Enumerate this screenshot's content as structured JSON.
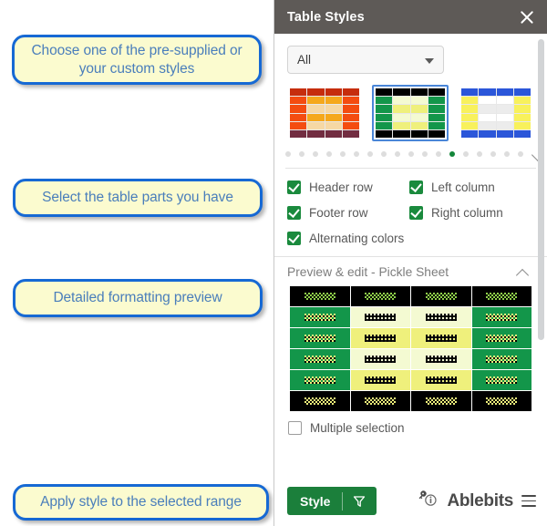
{
  "callouts": [
    {
      "id": "choose-style",
      "text": "Choose one of the pre-supplied or your custom styles"
    },
    {
      "id": "table-parts",
      "text": "Select the table parts you have"
    },
    {
      "id": "preview",
      "text": "Detailed formatting preview"
    },
    {
      "id": "apply",
      "text": "Apply style to the selected range"
    }
  ],
  "callout_colors": {
    "fill": "#fbfbcf",
    "border": "#1669d4",
    "text": "#4a7ebb"
  },
  "panel": {
    "title": "Table Styles",
    "close_icon": "close-icon",
    "titlebar_color": "#5e5a57",
    "filter": {
      "value": "All",
      "icon": "chevron-down-icon"
    },
    "thumbnails": [
      {
        "name": "orange-red-style",
        "selected": false,
        "rows": [
          [
            "#c62d0d",
            "#c62d0d",
            "#c62d0d",
            "#c62d0d"
          ],
          [
            "#f44c10",
            "#f5a81c",
            "#f5a81c",
            "#f44c10"
          ],
          [
            "#f44c10",
            "#f6d8a4",
            "#f6d8a4",
            "#f44c10"
          ],
          [
            "#f44c10",
            "#f5a81c",
            "#f5a81c",
            "#f44c10"
          ],
          [
            "#f44c10",
            "#f6d8a4",
            "#f6d8a4",
            "#f44c10"
          ],
          [
            "#722d41",
            "#722d41",
            "#722d41",
            "#722d41"
          ]
        ]
      },
      {
        "name": "green-yellow-style",
        "selected": true,
        "rows": [
          [
            "#000000",
            "#000000",
            "#000000",
            "#000000"
          ],
          [
            "#13964a",
            "#f4fad2",
            "#f4fad2",
            "#13964a"
          ],
          [
            "#13964a",
            "#eff07c",
            "#eff07c",
            "#13964a"
          ],
          [
            "#13964a",
            "#f4fad2",
            "#f4fad2",
            "#13964a"
          ],
          [
            "#13964a",
            "#eff07c",
            "#eff07c",
            "#13964a"
          ],
          [
            "#000000",
            "#000000",
            "#000000",
            "#000000"
          ]
        ]
      },
      {
        "name": "blue-yellow-style",
        "selected": false,
        "rows": [
          [
            "#2b56d9",
            "#2b56d9",
            "#2b56d9",
            "#2b56d9"
          ],
          [
            "#f8f15c",
            "#ffffff",
            "#ffffff",
            "#f8f15c"
          ],
          [
            "#f8f15c",
            "#ececec",
            "#ececec",
            "#f8f15c"
          ],
          [
            "#f8f15c",
            "#ffffff",
            "#ffffff",
            "#f8f15c"
          ],
          [
            "#f8f15c",
            "#ececec",
            "#ececec",
            "#f8f15c"
          ],
          [
            "#2b56d9",
            "#2b56d9",
            "#2b56d9",
            "#2b56d9"
          ]
        ]
      }
    ],
    "pagination": {
      "total": 18,
      "active_index": 12,
      "active_color": "#13863a",
      "expand_icon": "chevron-down-icon"
    },
    "options": [
      {
        "label": "Header row",
        "checked": true
      },
      {
        "label": "Left column",
        "checked": true
      },
      {
        "label": "Footer row",
        "checked": true
      },
      {
        "label": "Right column",
        "checked": true
      },
      {
        "label": "Alternating colors",
        "checked": true
      }
    ],
    "preview": {
      "title": "Preview & edit - Pickle Sheet",
      "collapse_icon": "chevron-up-icon",
      "rows": [
        {
          "type": "header",
          "cells": [
            "#000000",
            "#000000",
            "#000000",
            "#000000"
          ],
          "text": [
            "#8fd14a",
            "#8fd14a",
            "#8fd14a",
            "#8fd14a"
          ]
        },
        {
          "type": "band-light",
          "cells": [
            "#13964a",
            "#f4fad2",
            "#f4fad2",
            "#13964a"
          ],
          "text": [
            "#eff07c",
            "#111111",
            "#111111",
            "#eff07c"
          ]
        },
        {
          "type": "band-dark",
          "cells": [
            "#13964a",
            "#eff07c",
            "#eff07c",
            "#13964a"
          ],
          "text": [
            "#eff07c",
            "#111111",
            "#111111",
            "#eff07c"
          ]
        },
        {
          "type": "band-light",
          "cells": [
            "#13964a",
            "#f4fad2",
            "#f4fad2",
            "#13964a"
          ],
          "text": [
            "#eff07c",
            "#111111",
            "#111111",
            "#eff07c"
          ]
        },
        {
          "type": "band-dark",
          "cells": [
            "#13964a",
            "#eff07c",
            "#eff07c",
            "#13964a"
          ],
          "text": [
            "#eff07c",
            "#111111",
            "#111111",
            "#eff07c"
          ]
        },
        {
          "type": "footer",
          "cells": [
            "#000000",
            "#000000",
            "#000000",
            "#000000"
          ],
          "text": [
            "#eff07c",
            "#eff07c",
            "#eff07c",
            "#eff07c"
          ]
        }
      ]
    },
    "multiple_selection": {
      "label": "Multiple selection",
      "checked": false
    },
    "apply_button": {
      "label": "Style",
      "color": "#1b7f3b",
      "filter_icon": "funnel-icon"
    },
    "brand": {
      "name": "Ablebits",
      "info_icon": "key-info-icon",
      "menu_icon": "hamburger-icon",
      "dot_color": "#29a3e0"
    }
  }
}
